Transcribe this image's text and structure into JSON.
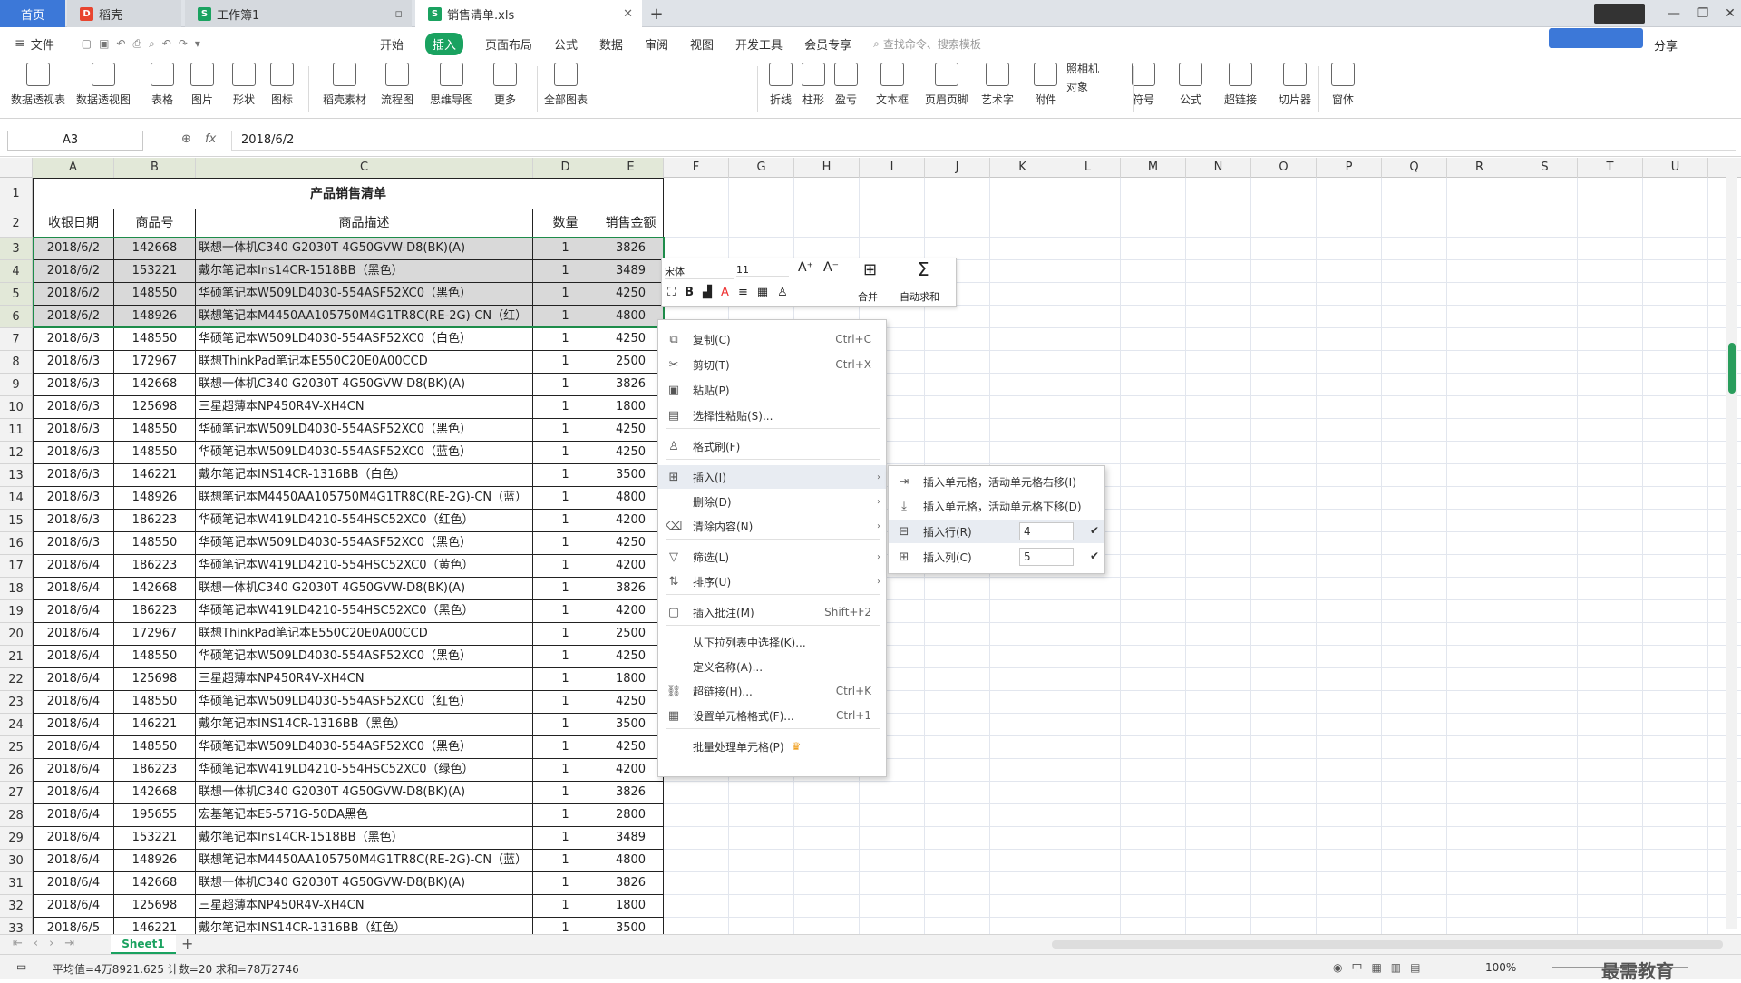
{
  "titlebar": {
    "tabs": [
      {
        "label": "首页"
      },
      {
        "label": "稻壳"
      },
      {
        "label": "工作簿1"
      },
      {
        "label": "销售清单.xls"
      }
    ],
    "new_tab": "+",
    "window_controls": {
      "minimize": "—",
      "restore": "❐",
      "close": "✕"
    }
  },
  "menu": {
    "file": "文件",
    "items": [
      "开始",
      "插入",
      "页面布局",
      "公式",
      "数据",
      "审阅",
      "视图",
      "开发工具",
      "会员专享"
    ],
    "active": "插入",
    "search_placeholder": "查找命令、搜索模板",
    "share": "分享"
  },
  "ribbon": {
    "buttons": [
      "数据透视表",
      "数据透视图",
      "表格",
      "图片",
      "形状",
      "图标",
      "稻壳素材",
      "流程图",
      "思维导图",
      "更多",
      "全部图表",
      "折线",
      "柱形",
      "盈亏",
      "文本框",
      "页眉页脚",
      "艺术字",
      "附件",
      "照相机",
      "对象",
      "符号",
      "公式",
      "超链接",
      "切片器",
      "窗体"
    ]
  },
  "formula_bar": {
    "name_box": "A3",
    "fx": "fx",
    "value": "2018/6/2"
  },
  "columns": [
    "A",
    "B",
    "C",
    "D",
    "E",
    "F",
    "G",
    "H",
    "I",
    "J",
    "K",
    "L",
    "M",
    "N",
    "O",
    "P",
    "Q",
    "R",
    "S",
    "T",
    "U"
  ],
  "sheet": {
    "title": "产品销售清单",
    "headers": [
      "收银日期",
      "商品号",
      "商品描述",
      "数量",
      "销售金额"
    ],
    "rows": [
      [
        "2018/6/2",
        "142668",
        "联想一体机C340 G2030T 4G50GVW-D8(BK)(A)",
        "1",
        "3826"
      ],
      [
        "2018/6/2",
        "153221",
        "戴尔笔记本Ins14CR-1518BB（黑色）",
        "1",
        "3489"
      ],
      [
        "2018/6/2",
        "148550",
        "华硕笔记本W509LD4030-554ASF52XC0（黑色）",
        "1",
        "4250"
      ],
      [
        "2018/6/2",
        "148926",
        "联想笔记本M4450AA105750M4G1TR8C(RE-2G)-CN（红）",
        "1",
        "4800"
      ],
      [
        "2018/6/3",
        "148550",
        "华硕笔记本W509LD4030-554ASF52XC0（白色）",
        "1",
        "4250"
      ],
      [
        "2018/6/3",
        "172967",
        "联想ThinkPad笔记本E550C20E0A00CCD",
        "1",
        "2500"
      ],
      [
        "2018/6/3",
        "142668",
        "联想一体机C340 G2030T 4G50GVW-D8(BK)(A)",
        "1",
        "3826"
      ],
      [
        "2018/6/3",
        "125698",
        "三星超薄本NP450R4V-XH4CN",
        "1",
        "1800"
      ],
      [
        "2018/6/3",
        "148550",
        "华硕笔记本W509LD4030-554ASF52XC0（黑色）",
        "1",
        "4250"
      ],
      [
        "2018/6/3",
        "148550",
        "华硕笔记本W509LD4030-554ASF52XC0（蓝色）",
        "1",
        "4250"
      ],
      [
        "2018/6/3",
        "146221",
        "戴尔笔记本INS14CR-1316BB（白色）",
        "1",
        "3500"
      ],
      [
        "2018/6/3",
        "148926",
        "联想笔记本M4450AA105750M4G1TR8C(RE-2G)-CN（蓝）",
        "1",
        "4800"
      ],
      [
        "2018/6/3",
        "186223",
        "华硕笔记本W419LD4210-554HSC52XC0（红色）",
        "1",
        "4200"
      ],
      [
        "2018/6/3",
        "148550",
        "华硕笔记本W509LD4030-554ASF52XC0（黑色）",
        "1",
        "4250"
      ],
      [
        "2018/6/4",
        "186223",
        "华硕笔记本W419LD4210-554HSC52XC0（黄色）",
        "1",
        "4200"
      ],
      [
        "2018/6/4",
        "142668",
        "联想一体机C340 G2030T 4G50GVW-D8(BK)(A)",
        "1",
        "3826"
      ],
      [
        "2018/6/4",
        "186223",
        "华硕笔记本W419LD4210-554HSC52XC0（黑色）",
        "1",
        "4200"
      ],
      [
        "2018/6/4",
        "172967",
        "联想ThinkPad笔记本E550C20E0A00CCD",
        "1",
        "2500"
      ],
      [
        "2018/6/4",
        "148550",
        "华硕笔记本W509LD4030-554ASF52XC0（黑色）",
        "1",
        "4250"
      ],
      [
        "2018/6/4",
        "125698",
        "三星超薄本NP450R4V-XH4CN",
        "1",
        "1800"
      ],
      [
        "2018/6/4",
        "148550",
        "华硕笔记本W509LD4030-554ASF52XC0（红色）",
        "1",
        "4250"
      ],
      [
        "2018/6/4",
        "146221",
        "戴尔笔记本INS14CR-1316BB（黑色）",
        "1",
        "3500"
      ],
      [
        "2018/6/4",
        "148550",
        "华硕笔记本W509LD4030-554ASF52XC0（黑色）",
        "1",
        "4250"
      ],
      [
        "2018/6/4",
        "186223",
        "华硕笔记本W419LD4210-554HSC52XC0（绿色）",
        "1",
        "4200"
      ],
      [
        "2018/6/4",
        "142668",
        "联想一体机C340 G2030T 4G50GVW-D8(BK)(A)",
        "1",
        "3826"
      ],
      [
        "2018/6/4",
        "195655",
        "宏基笔记本E5-571G-50DA黑色",
        "1",
        "2800"
      ],
      [
        "2018/6/4",
        "153221",
        "戴尔笔记本Ins14CR-1518BB（黑色）",
        "1",
        "3489"
      ],
      [
        "2018/6/4",
        "148926",
        "联想笔记本M4450AA105750M4G1TR8C(RE-2G)-CN（蓝）",
        "1",
        "4800"
      ],
      [
        "2018/6/4",
        "142668",
        "联想一体机C340 G2030T 4G50GVW-D8(BK)(A)",
        "1",
        "3826"
      ],
      [
        "2018/6/4",
        "125698",
        "三星超薄本NP450R4V-XH4CN",
        "1",
        "1800"
      ],
      [
        "2018/6/5",
        "146221",
        "戴尔笔记本INS14CR-1316BB（红色）",
        "1",
        "3500"
      ]
    ]
  },
  "mini_toolbar": {
    "font": "宋体",
    "size": "11",
    "merge": "合并",
    "autosum": "自动求和"
  },
  "context_menu": [
    {
      "label": "复制(C)",
      "shortcut": "Ctrl+C",
      "icon": "copy-icon"
    },
    {
      "label": "剪切(T)",
      "shortcut": "Ctrl+X",
      "icon": "scissors-icon"
    },
    {
      "label": "粘贴(P)",
      "shortcut": "",
      "icon": "paste-icon"
    },
    {
      "label": "选择性粘贴(S)...",
      "shortcut": "",
      "icon": "paste-special-icon"
    },
    {
      "label": "格式刷(F)",
      "shortcut": "",
      "icon": "format-painter-icon"
    },
    {
      "label": "插入(I)",
      "shortcut": "",
      "icon": "insert-icon",
      "arrow": true
    },
    {
      "label": "删除(D)",
      "shortcut": "",
      "icon": "",
      "arrow": true
    },
    {
      "label": "清除内容(N)",
      "shortcut": "",
      "icon": "eraser-icon",
      "arrow": true
    },
    {
      "label": "筛选(L)",
      "shortcut": "",
      "icon": "filter-icon",
      "arrow": true
    },
    {
      "label": "排序(U)",
      "shortcut": "",
      "icon": "sort-icon",
      "arrow": true
    },
    {
      "label": "插入批注(M)",
      "shortcut": "Shift+F2",
      "icon": "comment-icon"
    },
    {
      "label": "从下拉列表中选择(K)...",
      "shortcut": "",
      "icon": ""
    },
    {
      "label": "定义名称(A)...",
      "shortcut": "",
      "icon": ""
    },
    {
      "label": "超链接(H)...",
      "shortcut": "Ctrl+K",
      "icon": "link-icon"
    },
    {
      "label": "设置单元格格式(F)...",
      "shortcut": "Ctrl+1",
      "icon": "cell-format-icon"
    },
    {
      "label": "批量处理单元格(P)",
      "shortcut": "",
      "icon": "crown-icon"
    }
  ],
  "submenu": [
    {
      "label": "插入单元格，活动单元格右移(I)"
    },
    {
      "label": "插入单元格，活动单元格下移(D)"
    },
    {
      "label": "插入行(R)",
      "value": "4"
    },
    {
      "label": "插入列(C)",
      "value": "5"
    }
  ],
  "sheet_tabs": [
    "Sheet1"
  ],
  "status": {
    "summary": "平均值=4万8921.625  计数=20  求和=78万2746",
    "zoom": "100%"
  },
  "watermark": "最需教育",
  "colors": {
    "accent": "#3c78d8",
    "selection_border": "#1e8c4a",
    "active_tab": "#1aa260"
  }
}
